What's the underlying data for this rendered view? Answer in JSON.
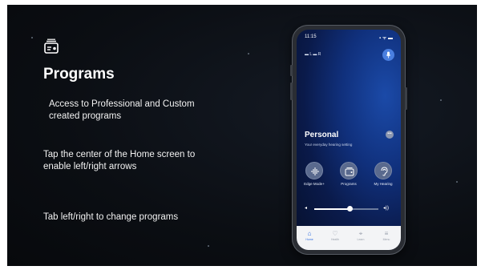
{
  "slide": {
    "title": "Programs",
    "icon": "program-card-icon",
    "bullets": [
      "Access to Professional and Custom created programs",
      "Tap the center of the Home screen to enable left/right arrows",
      "Tab left/right to change programs"
    ]
  },
  "phone": {
    "time": "11:15",
    "status_icons": "▪ ᯤ ▬",
    "hearing_aids": "▬ L   ▬ R",
    "program": {
      "name": "Personal",
      "subtitle": "Your everyday hearing setting"
    },
    "more_label": "•••",
    "actions": [
      {
        "label": "Edge Mode+",
        "icon": "waveform-icon"
      },
      {
        "label": "Programs",
        "icon": "program-card-icon"
      },
      {
        "label": "My Hearing",
        "icon": "ear-icon"
      }
    ],
    "volume": {
      "level": 0.55,
      "low_icon": "◂",
      "high_icon": "◂))"
    },
    "tabs": [
      {
        "label": "Home",
        "icon": "home-icon",
        "glyph": "⌂",
        "active": true
      },
      {
        "label": "Health",
        "icon": "heart-icon",
        "glyph": "♡",
        "active": false
      },
      {
        "label": "Learn",
        "icon": "graduation-cap-icon",
        "glyph": "⌖",
        "active": false
      },
      {
        "label": "Menu",
        "icon": "menu-icon",
        "glyph": "≡",
        "active": false
      }
    ],
    "accent_color": "#2d6be0"
  }
}
